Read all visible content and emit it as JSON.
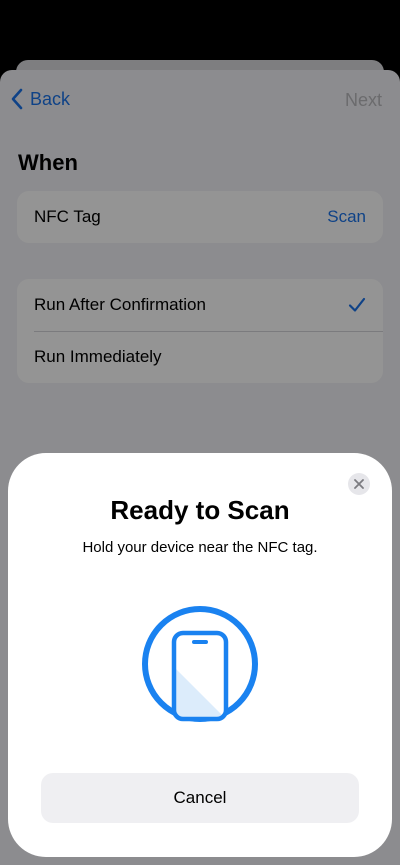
{
  "nav": {
    "back_label": "Back",
    "next_label": "Next"
  },
  "section": {
    "title": "When"
  },
  "trigger": {
    "label": "NFC Tag",
    "action": "Scan"
  },
  "run_options": [
    {
      "label": "Run After Confirmation",
      "selected": true
    },
    {
      "label": "Run Immediately",
      "selected": false
    }
  ],
  "modal": {
    "title": "Ready to Scan",
    "subtitle": "Hold your device near the NFC tag.",
    "cancel_label": "Cancel",
    "icon": "phone-scan-icon",
    "close_icon": "close-icon"
  },
  "colors": {
    "accent": "#1a73e8",
    "scan_ring": "#1a82f0",
    "scan_fill": "#dcecfb"
  }
}
